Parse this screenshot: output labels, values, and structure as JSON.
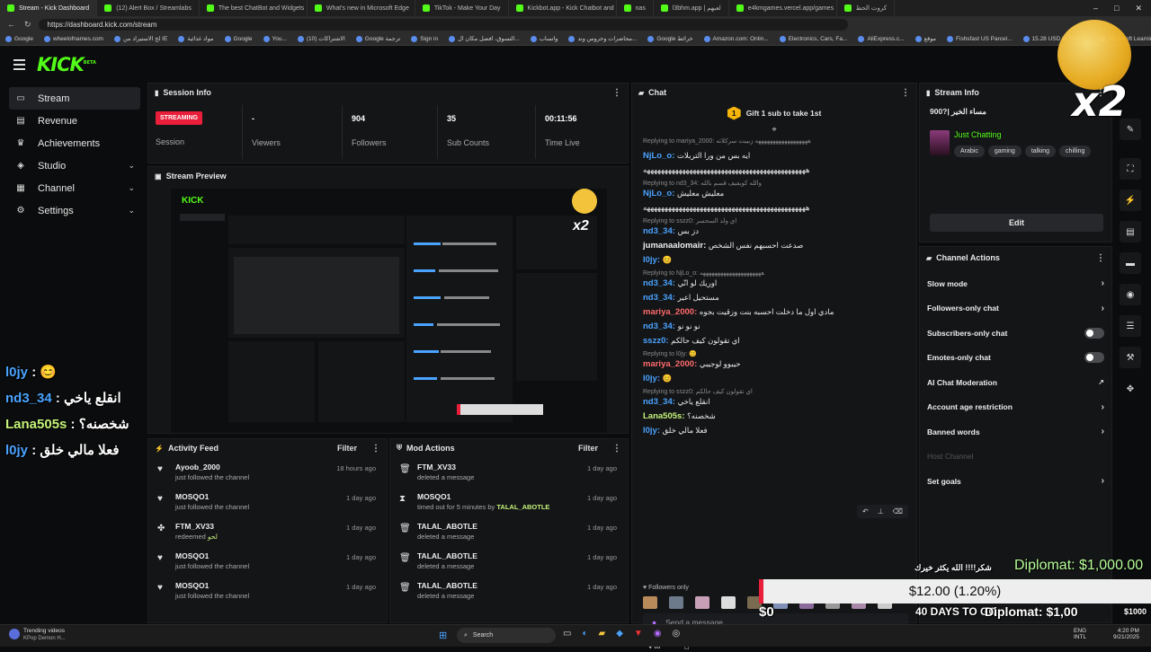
{
  "browser": {
    "tabs": [
      {
        "label": "Stream - Kick Dashboard",
        "active": true
      },
      {
        "label": "(12) Alert Box / Streamlabs"
      },
      {
        "label": "The best ChatBot and Widgets"
      },
      {
        "label": "What's new in Microsoft Edge"
      },
      {
        "label": "TikTok - Make Your Day"
      },
      {
        "label": "Kickbot.app - Kick Chatbot and"
      },
      {
        "label": "nas"
      },
      {
        "label": "l3bhm.app | لعبهم"
      },
      {
        "label": "e4kmgames.vercel.app/games"
      },
      {
        "label": "كروت الحظ"
      }
    ],
    "url": "https://dashboard.kick.com/stream",
    "bookmarks": [
      "Google",
      "wheelofnames.com",
      "لخ الاستيراد من IE",
      "مواد غذائية",
      "Google",
      "You...",
      "(10) الاشتراكات",
      "Google ترجمة",
      "Sign in",
      "التسوق، افضل مكان ال...",
      "واتساب",
      "محاضرات وحروس وند...",
      "Google خرائط",
      "Amazon.com: Onlin...",
      "Electronics, Cars, Fa...",
      "AliExpress.c...",
      "موقع",
      "Fishsfast US Parcel...",
      "15.28 USD to SAR |...",
      "Microsoft Learning"
    ]
  },
  "sidebar": {
    "items": [
      {
        "label": "Stream",
        "icon": "monitor-icon",
        "active": true
      },
      {
        "label": "Revenue",
        "icon": "wallet-icon"
      },
      {
        "label": "Achievements",
        "icon": "trophy-icon"
      },
      {
        "label": "Studio",
        "icon": "studio-icon",
        "chevron": true
      },
      {
        "label": "Channel",
        "icon": "channel-icon",
        "chevron": true
      },
      {
        "label": "Settings",
        "icon": "gear-icon",
        "chevron": true
      }
    ]
  },
  "session": {
    "title": "Session Info",
    "badge": "STREAMING",
    "session_label": "Session",
    "stats": [
      {
        "value": "-",
        "label": "Viewers"
      },
      {
        "value": "904",
        "label": "Followers"
      },
      {
        "value": "35",
        "label": "Sub Counts"
      },
      {
        "value": "00:11:56",
        "label": "Time Live"
      }
    ]
  },
  "preview": {
    "title": "Stream Preview"
  },
  "activity": {
    "title": "Activity Feed",
    "filter": "Filter",
    "items": [
      {
        "name": "Ayoob_2000",
        "desc": "just followed the channel",
        "time": "18 hours ago",
        "icon": "heart-icon"
      },
      {
        "name": "MOSQO1",
        "desc": "just followed the channel",
        "time": "1 day ago",
        "icon": "heart-icon"
      },
      {
        "name": "FTM_XV33",
        "desc": "redeemed",
        "extra": "لحو",
        "time": "1 day ago",
        "icon": "redeem-icon"
      },
      {
        "name": "MOSQO1",
        "desc": "just followed the channel",
        "time": "1 day ago",
        "icon": "heart-icon"
      },
      {
        "name": "MOSQO1",
        "desc": "just followed the channel",
        "time": "1 day ago",
        "icon": "heart-icon"
      }
    ]
  },
  "mod": {
    "title": "Mod Actions",
    "filter": "Filter",
    "items": [
      {
        "name": "FTM_XV33",
        "desc": "deleted a message",
        "time": "1 day ago",
        "icon": "trash-icon"
      },
      {
        "name": "MOSQO1",
        "desc": "timed out for 5 minutes by",
        "by": "TALAL_ABOTLE",
        "time": "1 day ago",
        "icon": "hourglass-icon"
      },
      {
        "name": "TALAL_ABOTLE",
        "desc": "deleted a message",
        "time": "1 day ago",
        "icon": "trash-icon"
      },
      {
        "name": "TALAL_ABOTLE",
        "desc": "deleted a message",
        "time": "1 day ago",
        "icon": "trash-icon"
      },
      {
        "name": "TALAL_ABOTLE",
        "desc": "deleted a message",
        "time": "1 day ago",
        "icon": "trash-icon"
      }
    ]
  },
  "chat": {
    "title": "Chat",
    "gift_rank": "1",
    "gift_text": "Gift 1 sub to take 1st",
    "top_reply": "Replying to mariya_2000: ههههههههههههههههههه زبيبت سركلاته",
    "messages": [
      {
        "reply": "",
        "user": "NjLo_o",
        "color": "#4aa3ff",
        "text": "ايه بس من ورا التربلات"
      },
      {
        "reply": "",
        "user": "",
        "color": "#4aa3ff",
        "text": "ههههههههههههههههههههههههههههههههههههههههههههههه"
      },
      {
        "reply": "Replying to nd3_34: والله كويفيف قسم بالله",
        "user": "NjLo_o",
        "color": "#4aa3ff",
        "text": "معليش معليش"
      },
      {
        "reply": "",
        "user": "",
        "color": "#4aa3ff",
        "text": "ههههههههههههههههههههههههههههههههههههههههههههههه"
      },
      {
        "reply": "Replying to sszz0: اي ولد السحسر",
        "user": "nd3_34",
        "color": "#4aa3ff",
        "text": "دز بس"
      },
      {
        "reply": "",
        "user": "jumanaalomair",
        "color": "#f0f0f0",
        "text": "صدعت احسبهم نفس الشخص"
      },
      {
        "reply": "",
        "user": "l0jy",
        "color": "#4aa3ff",
        "text": "😊"
      },
      {
        "reply": "Replying to NjLo_o: هههههههههههههههههههههه",
        "user": "nd3_34",
        "color": "#4aa3ff",
        "text": "اوريك لو انّي"
      },
      {
        "reply": "",
        "user": "nd3_34",
        "color": "#4aa3ff",
        "text": "مستحيل اعير"
      },
      {
        "reply": "",
        "user": "mariya_2000",
        "color": "#ff6b6b",
        "text": "مادي اول ما دخلت احسبه بنت وزقيت بجوه"
      },
      {
        "reply": "",
        "user": "nd3_34",
        "color": "#4aa3ff",
        "text": "نو نو نو"
      },
      {
        "reply": "",
        "user": "sszz0",
        "color": "#4aa3ff",
        "text": "اي تقولون كيف حالكم"
      },
      {
        "reply": "Replying to l0jy: 😊",
        "user": "mariya_2000",
        "color": "#ff6b6b",
        "text": "حيبوو لوجيبي"
      },
      {
        "reply": "",
        "user": "l0jy",
        "color": "#4aa3ff",
        "text": "😊"
      },
      {
        "reply": "Replying to sszz0: اي تقولون كيف حالكم",
        "user": "nd3_34",
        "color": "#4aa3ff",
        "text": "انقلع ياخي"
      },
      {
        "reply": "",
        "user": "Lana505s",
        "color": "#c4f27a",
        "text": "شخصنه؟"
      },
      {
        "reply": "",
        "user": "l0jy",
        "color": "#4aa3ff",
        "text": "فعلا مالي خلق"
      }
    ],
    "followers_only": "Followers only",
    "input_placeholder": "Send a message"
  },
  "stream_info": {
    "title": "Stream Info",
    "stream_title": "900?| مساء الخير",
    "category": "Just Chatting",
    "tags": [
      "Arabic",
      "gaming",
      "talking",
      "chilling"
    ],
    "edit": "Edit"
  },
  "channel_actions": {
    "title": "Channel Actions",
    "items": [
      {
        "label": "Slow mode",
        "control": "chevron"
      },
      {
        "label": "Followers-only chat",
        "control": "chevron"
      },
      {
        "label": "Subscribers-only chat",
        "control": "toggle"
      },
      {
        "label": "Emotes-only chat",
        "control": "toggle"
      },
      {
        "label": "AI Chat Moderation",
        "control": "external"
      },
      {
        "label": "Account age restriction",
        "control": "chevron"
      },
      {
        "label": "Banned words",
        "control": "chevron"
      },
      {
        "label": "Host Channel",
        "control": "none",
        "disabled": true
      },
      {
        "label": "Set goals",
        "control": "chevron"
      }
    ]
  },
  "overlay": {
    "multiplier": "x2",
    "left_chat": [
      {
        "user": "l0jy",
        "text": "😊"
      },
      {
        "user": "nd3_34",
        "text": "انقلع ياخي"
      },
      {
        "user": "Lana505s",
        "text": "شخصنه؟"
      },
      {
        "user": "l0jy",
        "text": "فعلا مالي خلق"
      }
    ],
    "goal_name": "Diplomat: $1,000.00",
    "goal_progress_text": "$12.00 (1.20%)",
    "goal_progress": 0.012,
    "goal_thanks": "شكر!!!! الله يكثر خيرك",
    "goal_start": "$0",
    "goal_days": "40 DAYS TO GO",
    "goal_end_label": "Diplomat: $1,00",
    "goal_side": "$1000"
  },
  "taskbar": {
    "news_title": "Trending videos",
    "news_sub": "KPop Demon H...",
    "search": "Search",
    "lang": "ENG",
    "lang2": "INTL",
    "time": "4:20 PM",
    "date": "9/21/2025"
  },
  "colors": {
    "kick_green": "#53fc18",
    "streaming_red": "#e91e3a",
    "panel": "#141517"
  }
}
